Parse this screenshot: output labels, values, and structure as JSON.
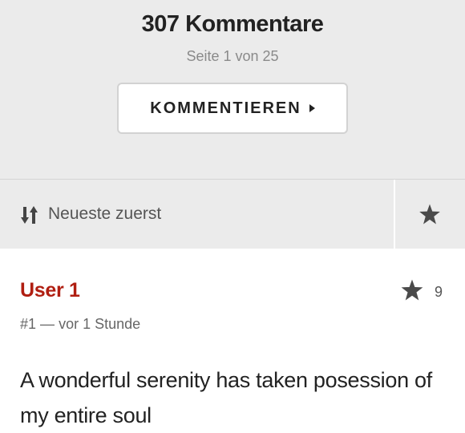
{
  "header": {
    "title": "307 Kommentare",
    "page_info": "Seite 1 von 25",
    "comment_button_label": "KOMMENTIEREN"
  },
  "sort": {
    "label": "Neueste zuerst",
    "icon": "sort-arrows-icon",
    "favorites_icon": "star-icon"
  },
  "comment": {
    "user": "User 1",
    "rating_count": "9",
    "number": "#1",
    "separator": "—",
    "time": "vor 1 Stunde",
    "text": "A wonderful serenity has taken posession of my entire soul"
  },
  "colors": {
    "accent": "#b01e11",
    "header_bg": "#ebebeb",
    "text": "#222222",
    "muted": "#8a8a8a"
  }
}
